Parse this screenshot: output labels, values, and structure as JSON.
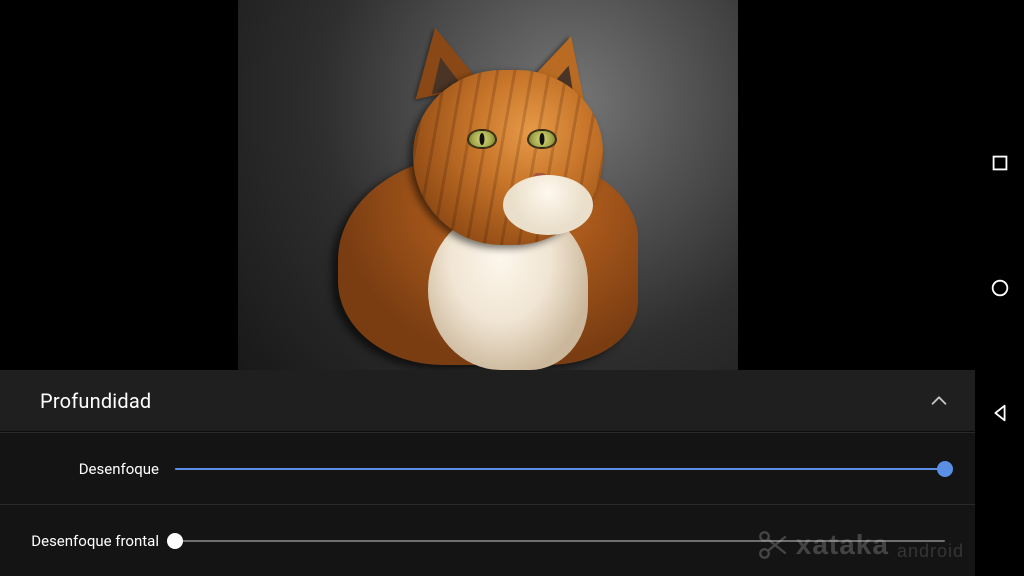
{
  "panel": {
    "title": "Profundidad",
    "collapse_icon": "chevron-up",
    "sliders": [
      {
        "label": "Desenfoque",
        "value_percent": 100,
        "active_color": "#5b8ee5",
        "thumb_color": "#5b8ee5"
      },
      {
        "label": "Desenfoque frontal",
        "value_percent": 0,
        "active_color": "#6f6f6f",
        "thumb_color": "#ffffff"
      }
    ]
  },
  "navbar": {
    "recent_icon": "square",
    "home_icon": "circle",
    "back_icon": "triangle-left"
  },
  "watermark": {
    "brand": "xataka",
    "sub": "android"
  },
  "image": {
    "subject": "orange-and-white-tabby-cat",
    "background": "grayscale-blurred"
  }
}
